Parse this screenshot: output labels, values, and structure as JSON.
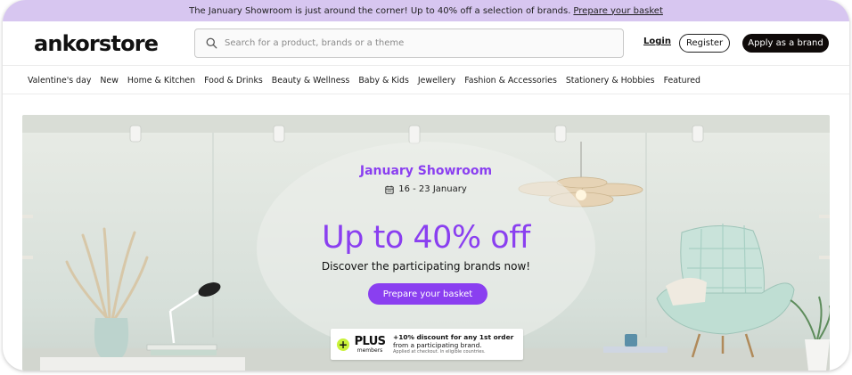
{
  "promo": {
    "text": "The January Showroom is just around the corner! Up to 40% off a selection of brands.",
    "link": "Prepare your basket"
  },
  "header": {
    "logo": "ankorstore",
    "search_placeholder": "Search for a product, brands or a theme",
    "login": "Login",
    "register": "Register",
    "apply": "Apply as a brand"
  },
  "nav": {
    "items": [
      "Valentine's day",
      "New",
      "Home & Kitchen",
      "Food & Drinks",
      "Beauty & Wellness",
      "Baby & Kids",
      "Jewellery",
      "Fashion & Accessories",
      "Stationery & Hobbies",
      "Featured"
    ]
  },
  "hero": {
    "title": "January Showroom",
    "dates": "16 - 23 January",
    "headline": "Up to 40% off",
    "subheadline": "Discover the participating brands now!",
    "cta": "Prepare your basket"
  },
  "plus": {
    "badge": "+",
    "logo": "PLUS",
    "members": "members",
    "line1": "+10% discount for any 1st order",
    "line2": "from a participating brand.",
    "line3": "Applied at checkout. In eligible countries."
  },
  "colors": {
    "promo_bg": "#d7c6f0",
    "accent_purple": "#8a3ff0",
    "apply_bg": "#0f0a09",
    "plus_green": "#c9f23a"
  },
  "icons": {
    "search": "search-icon",
    "calendar": "calendar-icon",
    "plus_badge": "plus-icon"
  }
}
